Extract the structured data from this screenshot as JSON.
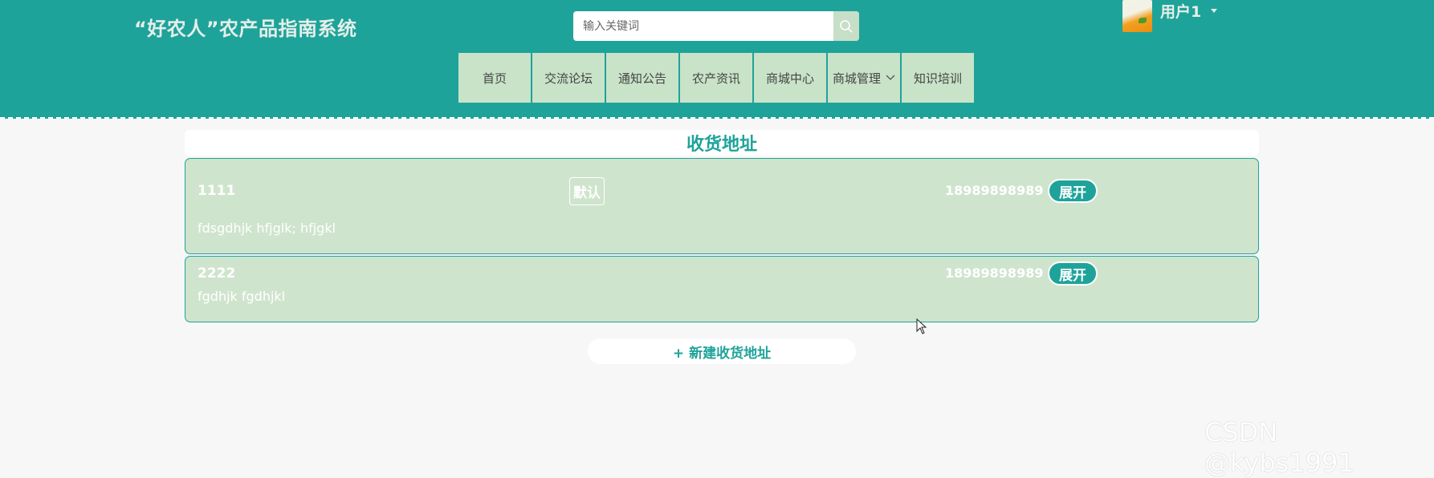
{
  "header": {
    "site_title": "“好农人”农产品指南系统",
    "search_placeholder": "输入关键词",
    "username": "用户1"
  },
  "nav": {
    "items": [
      {
        "label": "首页"
      },
      {
        "label": "交流论坛"
      },
      {
        "label": "通知公告"
      },
      {
        "label": "农产资讯"
      },
      {
        "label": "商城中心"
      },
      {
        "label": "商城管理",
        "has_dropdown": true
      },
      {
        "label": "知识培训"
      }
    ]
  },
  "main": {
    "title": "收货地址",
    "addresses": [
      {
        "name": "1111",
        "is_default_label": "默认",
        "phone": "18989898989",
        "expand_label": "展开",
        "address": "fdsgdhjk hfjglk; hfjgkl"
      },
      {
        "name": "2222",
        "phone": "18989898989",
        "expand_label": "展开",
        "address": "fgdhjk fgdhjkl"
      }
    ],
    "new_address_label": "+ 新建收货地址"
  },
  "watermark": "CSDN @kybs1991",
  "colors": {
    "brand_teal": "#1ea39a",
    "nav_bg": "#c9e3c9",
    "card_bg": "#cfe4cd",
    "page_bg": "#f7f7f7"
  }
}
